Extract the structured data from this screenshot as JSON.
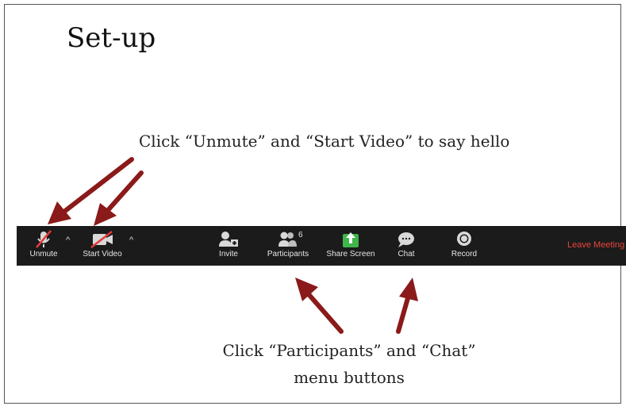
{
  "slide": {
    "title": "Set-up",
    "caption_top": "Click “Unmute” and “Start Video” to say hello",
    "caption_bottom_line1": "Click “Participants” and “Chat”",
    "caption_bottom_line2": "menu buttons"
  },
  "toolbar": {
    "unmute_label": "Unmute",
    "start_video_label": "Start Video",
    "caret": "^",
    "invite_label": "Invite",
    "participants_label": "Participants",
    "participants_count": "6",
    "share_screen_label": "Share Screen",
    "chat_label": "Chat",
    "record_label": "Record",
    "leave_label": "Leave Meeting"
  },
  "colors": {
    "toolbar_bg": "#1b1b1b",
    "arrow": "#8b1a1a",
    "share_green": "#3fb54a",
    "leave_red": "#e8453c",
    "mute_slash": "#e23b3b"
  },
  "icons": {
    "unmute": "muted-microphone-icon",
    "start_video": "video-off-icon",
    "invite": "invite-person-icon",
    "participants": "participants-icon",
    "share_screen": "share-screen-icon",
    "chat": "chat-bubble-icon",
    "record": "record-icon"
  }
}
